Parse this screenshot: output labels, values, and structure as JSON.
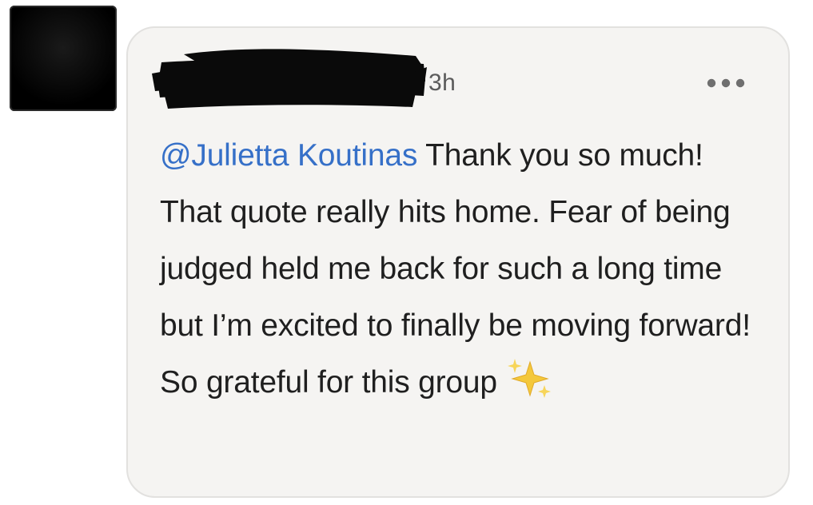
{
  "comment": {
    "author_name": "[redacted]",
    "timestamp": "3h",
    "mention": "@Julietta Koutinas",
    "body_text": " Thank you so much! That quote really hits home. Fear of being judged held me back for such a long time but I’m excited to finally be moving forward! So grateful for this group ",
    "emoji": "✨"
  },
  "icons": {
    "more_menu": "more-horizontal-icon",
    "sparkles": "sparkles-icon"
  },
  "colors": {
    "mention": "#3670c8",
    "bubble_background": "#f5f4f2",
    "text": "#1f1f1f",
    "timestamp": "#5b5b5b"
  }
}
